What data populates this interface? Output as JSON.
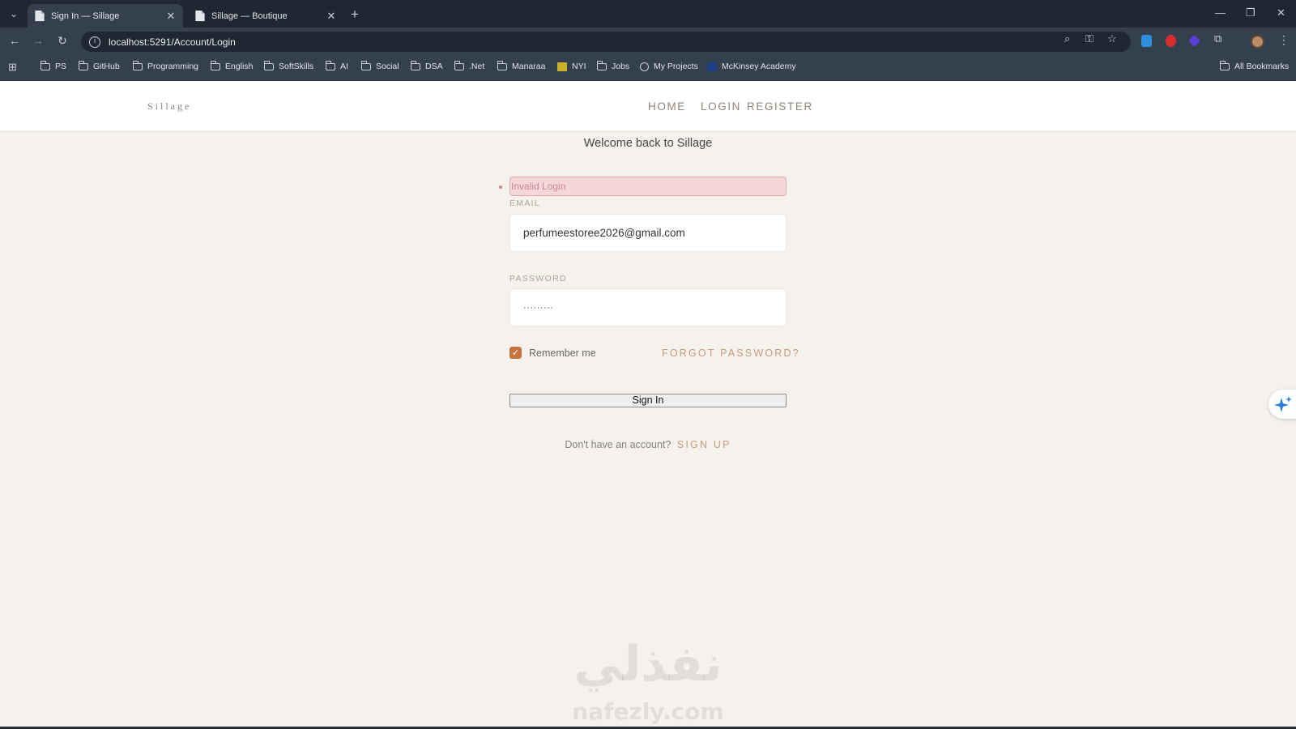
{
  "browser": {
    "tabs": [
      {
        "title": "Sign In — Sillage",
        "active": true
      },
      {
        "title": "Sillage — Boutique",
        "active": false
      }
    ],
    "url": "localhost:5291/Account/Login",
    "bookmarks": [
      "PS",
      "GitHub",
      "Programming",
      "English",
      "SoftSkills",
      "AI",
      "Social",
      "DSA",
      ".Net",
      "Manaraa",
      "NYI",
      "Jobs",
      "My Projects",
      "McKinsey Academy"
    ],
    "all_bookmarks": "All Bookmarks"
  },
  "site": {
    "logo": "Sillage",
    "nav": {
      "home": "HOME",
      "login": "LOGIN",
      "register": "REGISTER"
    }
  },
  "login": {
    "welcome": "Welcome back to Sillage",
    "error": "Invalid Login",
    "email_label": "EMAIL",
    "email_value": "perfumeestoree2026@gmail.com",
    "password_label": "PASSWORD",
    "password_value": "·········",
    "remember_label": "Remember me",
    "remember_checked": true,
    "forgot_label": "FORGOT PASSWORD?",
    "submit_label": "Sign In",
    "no_account": "Don't have an account?",
    "signup_label": "SIGN UP"
  },
  "watermark": {
    "arabic": "نفذلي",
    "latin": "nafezly.com"
  },
  "colors": {
    "accent": "#c5763f",
    "link": "#c59b7d",
    "error_bg": "#f6d7d8",
    "page_bg": "#f5f1ec"
  }
}
